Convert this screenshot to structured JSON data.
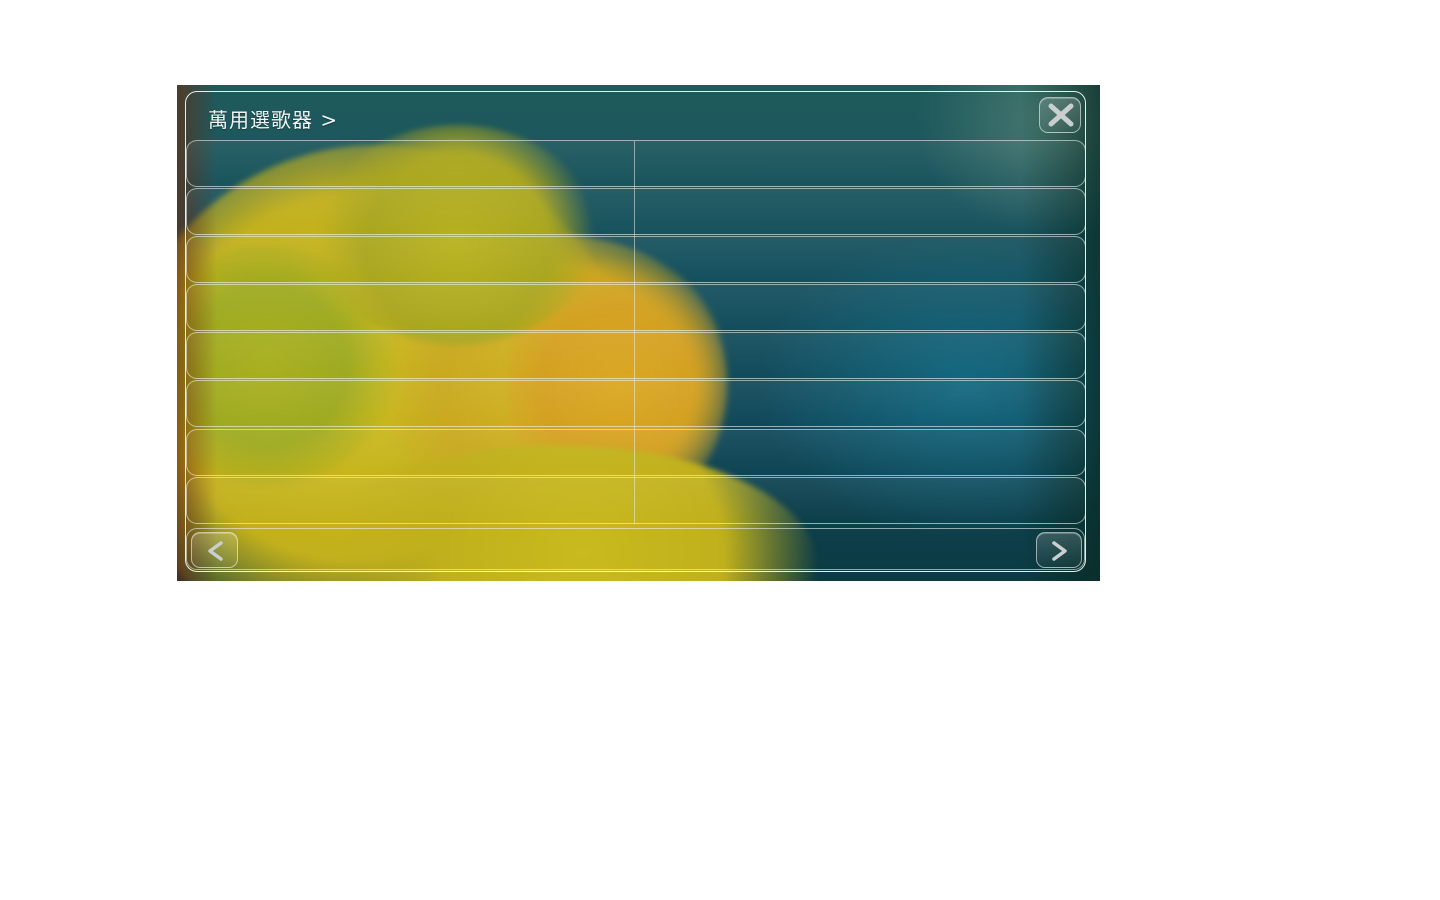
{
  "window": {
    "title": "萬用選歌器 >"
  },
  "icons": {
    "close": "close-x-icon",
    "prev": "chevron-left-icon",
    "next": "chevron-right-icon"
  },
  "list": {
    "rows": [
      {
        "left": "",
        "right": ""
      },
      {
        "left": "",
        "right": ""
      },
      {
        "left": "",
        "right": ""
      },
      {
        "left": "",
        "right": ""
      },
      {
        "left": "",
        "right": ""
      },
      {
        "left": "",
        "right": ""
      },
      {
        "left": "",
        "right": ""
      },
      {
        "left": "",
        "right": ""
      }
    ]
  },
  "colors": {
    "frame_border": "#ffffff",
    "text": "#f2f2f2",
    "background_teal": "#15505f",
    "flower_yellow": "#d8c020"
  }
}
